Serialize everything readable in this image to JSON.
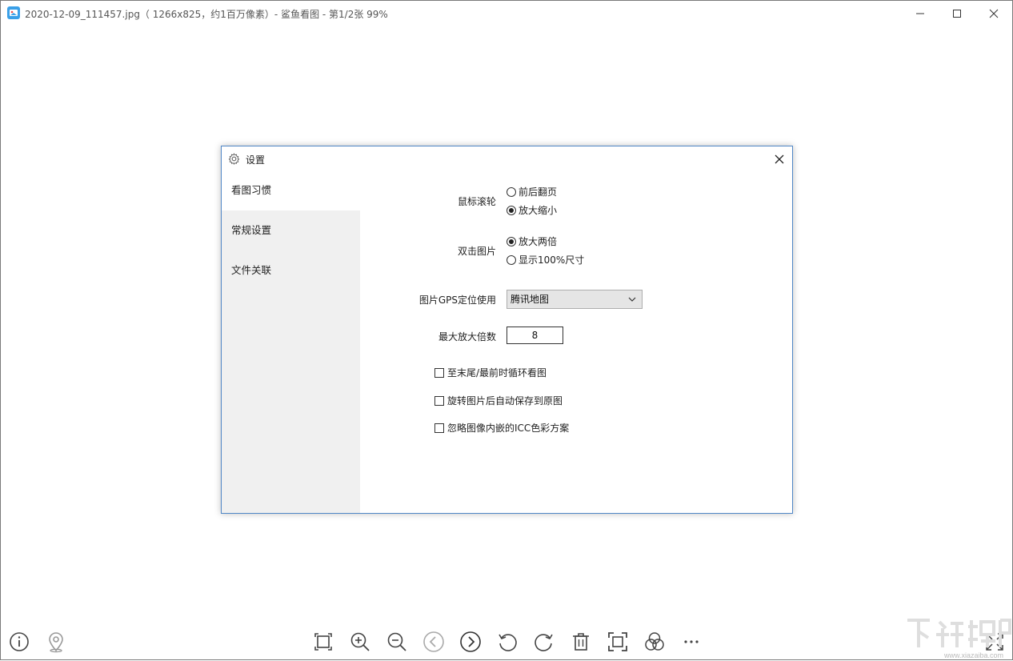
{
  "window": {
    "title": "2020-12-09_111457.jpg（ 1266x825，约1百万像素）- 鲨鱼看图 - 第1/2张 99%",
    "controls": [
      "minimize-icon",
      "maximize-icon",
      "close-icon"
    ]
  },
  "dialog": {
    "title": "设置",
    "sidebar": {
      "items": [
        {
          "label": "看图习惯",
          "active": true
        },
        {
          "label": "常规设置",
          "active": false
        },
        {
          "label": "文件关联",
          "active": false
        }
      ]
    },
    "settings": {
      "mouse_wheel": {
        "label": "鼠标滚轮",
        "options": [
          "前后翻页",
          "放大缩小"
        ],
        "selected": 1
      },
      "double_click": {
        "label": "双击图片",
        "options": [
          "放大两倍",
          "显示100%尺寸"
        ],
        "selected": 0
      },
      "gps": {
        "label": "图片GPS定位使用",
        "value": "腾讯地图"
      },
      "max_zoom": {
        "label": "最大放大倍数",
        "value": "8"
      },
      "checkboxes": [
        {
          "label": "至末尾/最前时循环看图",
          "checked": false
        },
        {
          "label": "旋转图片后自动保存到原图",
          "checked": false
        },
        {
          "label": "忽略图像内嵌的ICC色彩方案",
          "checked": false
        }
      ]
    }
  },
  "toolbar": {
    "left": [
      "info-icon",
      "location-pin-icon"
    ],
    "center": [
      "fit-screen-icon",
      "zoom-in-icon",
      "zoom-out-icon",
      "previous-icon",
      "next-icon",
      "rotate-left-icon",
      "rotate-right-icon",
      "delete-icon",
      "crop-icon",
      "filter-icon",
      "more-icon"
    ],
    "right": [
      "fullscreen-icon"
    ]
  },
  "watermark": {
    "url": "www.xiazaiba.com"
  }
}
